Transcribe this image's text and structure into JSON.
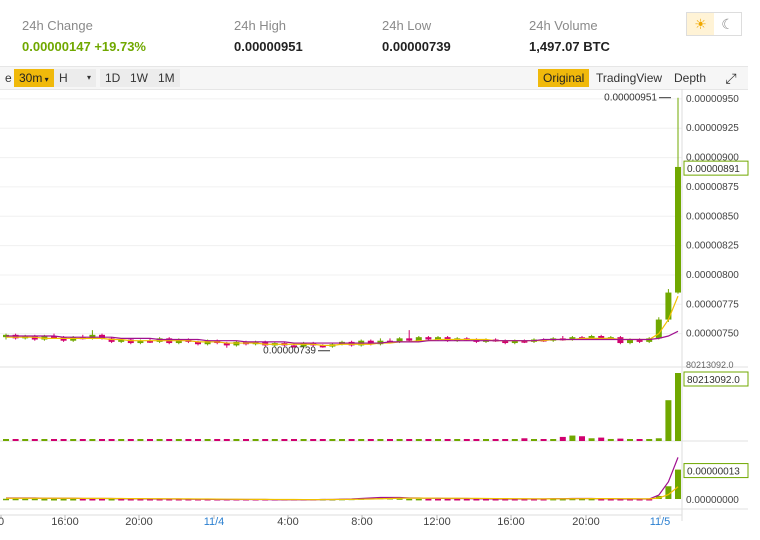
{
  "stats": {
    "change_label": "24h Change",
    "change_value": "0.00000147",
    "change_pct": "+19.73%",
    "high_label": "24h High",
    "high_value": "0.00000951",
    "low_label": "24h Low",
    "low_value": "0.00000739",
    "volume_label": "24h Volume",
    "volume_value": "1,497.07 BTC"
  },
  "theme": {
    "light_icon": "sun-icon",
    "dark_icon": "moon-icon"
  },
  "toolbar": {
    "partial_label": "e",
    "intervals": [
      "30m",
      "H",
      "1D",
      "1W",
      "1M"
    ],
    "active_interval": "30m",
    "views": [
      "Original",
      "TradingView",
      "Depth"
    ],
    "active_view": "Original",
    "expand_icon": "fullscreen-icon"
  },
  "colors": {
    "up": "#70a800",
    "down": "#d0006f",
    "accent": "#f0b90b",
    "ma1": "#f0c000",
    "ma2": "#a01090"
  },
  "chart_data": {
    "type": "candlestick",
    "x_ticks": [
      "0",
      "16:00",
      "20:00",
      "11/4",
      "4:00",
      "8:00",
      "12:00",
      "16:00",
      "20:00",
      "11/5"
    ],
    "x_ticks_highlight": [
      "11/4",
      "11/5"
    ],
    "price_axis": {
      "ticks": [
        "0.00000950",
        "0.00000925",
        "0.00000900",
        "0.00000875",
        "0.00000850",
        "0.00000825",
        "0.00000800",
        "0.00000775",
        "0.00000750"
      ],
      "ylim": [
        7.25e-06,
        9.55e-06
      ],
      "current_label": "0.00000891"
    },
    "high_marker": "0.00000951",
    "low_marker": "0.00000739",
    "volume_axis": {
      "top_label": "80213092.0",
      "current_label": "80213092.0"
    },
    "indicator_axis": {
      "current_label": "0.00000013",
      "zero_label": "0.00000000"
    },
    "candles": [
      [
        7.47,
        7.49,
        7.45,
        7.5
      ],
      [
        7.49,
        7.46,
        7.45,
        7.5
      ],
      [
        7.46,
        7.48,
        7.45,
        7.49
      ],
      [
        7.48,
        7.45,
        7.44,
        7.49
      ],
      [
        7.45,
        7.48,
        7.44,
        7.49
      ],
      [
        7.48,
        7.47,
        7.46,
        7.5
      ],
      [
        7.47,
        7.44,
        7.43,
        7.48
      ],
      [
        7.44,
        7.47,
        7.43,
        7.48
      ],
      [
        7.47,
        7.46,
        7.45,
        7.49
      ],
      [
        7.46,
        7.49,
        7.45,
        7.53
      ],
      [
        7.49,
        7.46,
        7.45,
        7.5
      ],
      [
        7.46,
        7.43,
        7.42,
        7.47
      ],
      [
        7.43,
        7.45,
        7.42,
        7.46
      ],
      [
        7.45,
        7.42,
        7.41,
        7.46
      ],
      [
        7.42,
        7.44,
        7.41,
        7.45
      ],
      [
        7.44,
        7.43,
        7.42,
        7.46
      ],
      [
        7.43,
        7.46,
        7.42,
        7.47
      ],
      [
        7.46,
        7.42,
        7.41,
        7.47
      ],
      [
        7.42,
        7.45,
        7.41,
        7.46
      ],
      [
        7.45,
        7.43,
        7.42,
        7.46
      ],
      [
        7.43,
        7.41,
        7.4,
        7.44
      ],
      [
        7.41,
        7.44,
        7.4,
        7.45
      ],
      [
        7.44,
        7.42,
        7.41,
        7.45
      ],
      [
        7.42,
        7.4,
        7.38,
        7.43
      ],
      [
        7.4,
        7.43,
        7.39,
        7.44
      ],
      [
        7.43,
        7.41,
        7.4,
        7.44
      ],
      [
        7.41,
        7.43,
        7.4,
        7.44
      ],
      [
        7.43,
        7.4,
        7.39,
        7.44
      ],
      [
        7.4,
        7.42,
        7.39,
        7.43
      ],
      [
        7.42,
        7.4,
        7.39,
        7.43
      ],
      [
        7.4,
        7.39,
        7.38,
        7.42
      ],
      [
        7.39,
        7.42,
        7.38,
        7.43
      ],
      [
        7.42,
        7.4,
        7.39,
        7.43
      ],
      [
        7.4,
        7.39,
        7.38,
        7.41
      ],
      [
        7.39,
        7.41,
        7.38,
        7.42
      ],
      [
        7.41,
        7.43,
        7.4,
        7.44
      ],
      [
        7.43,
        7.4,
        7.39,
        7.44
      ],
      [
        7.4,
        7.44,
        7.39,
        7.45
      ],
      [
        7.44,
        7.41,
        7.4,
        7.45
      ],
      [
        7.41,
        7.44,
        7.4,
        7.46
      ],
      [
        7.44,
        7.43,
        7.42,
        7.46
      ],
      [
        7.43,
        7.46,
        7.42,
        7.47
      ],
      [
        7.46,
        7.44,
        7.43,
        7.53
      ],
      [
        7.44,
        7.47,
        7.43,
        7.48
      ],
      [
        7.47,
        7.45,
        7.44,
        7.48
      ],
      [
        7.45,
        7.47,
        7.44,
        7.48
      ],
      [
        7.47,
        7.44,
        7.43,
        7.48
      ],
      [
        7.44,
        7.46,
        7.43,
        7.47
      ],
      [
        7.46,
        7.45,
        7.44,
        7.47
      ],
      [
        7.45,
        7.43,
        7.42,
        7.46
      ],
      [
        7.43,
        7.45,
        7.42,
        7.46
      ],
      [
        7.45,
        7.44,
        7.43,
        7.46
      ],
      [
        7.44,
        7.42,
        7.41,
        7.45
      ],
      [
        7.42,
        7.44,
        7.41,
        7.45
      ],
      [
        7.44,
        7.43,
        7.42,
        7.45
      ],
      [
        7.43,
        7.45,
        7.42,
        7.46
      ],
      [
        7.45,
        7.44,
        7.43,
        7.46
      ],
      [
        7.44,
        7.46,
        7.43,
        7.47
      ],
      [
        7.46,
        7.45,
        7.44,
        7.48
      ],
      [
        7.45,
        7.47,
        7.44,
        7.48
      ],
      [
        7.47,
        7.46,
        7.45,
        7.48
      ],
      [
        7.46,
        7.48,
        7.45,
        7.49
      ],
      [
        7.48,
        7.46,
        7.45,
        7.49
      ],
      [
        7.46,
        7.47,
        7.45,
        7.48
      ],
      [
        7.47,
        7.42,
        7.41,
        7.48
      ],
      [
        7.42,
        7.45,
        7.41,
        7.46
      ],
      [
        7.45,
        7.43,
        7.42,
        7.46
      ],
      [
        7.43,
        7.46,
        7.42,
        7.47
      ],
      [
        7.46,
        7.62,
        7.45,
        7.64
      ],
      [
        7.62,
        7.85,
        7.6,
        7.88
      ],
      [
        7.85,
        8.92,
        7.84,
        9.51
      ]
    ],
    "ma_fast": [
      7.47,
      7.47,
      7.47,
      7.47,
      7.46,
      7.46,
      7.46,
      7.46,
      7.46,
      7.46,
      7.46,
      7.45,
      7.45,
      7.44,
      7.44,
      7.44,
      7.44,
      7.44,
      7.44,
      7.44,
      7.43,
      7.43,
      7.43,
      7.42,
      7.42,
      7.42,
      7.42,
      7.41,
      7.41,
      7.41,
      7.41,
      7.41,
      7.41,
      7.4,
      7.4,
      7.41,
      7.41,
      7.41,
      7.41,
      7.42,
      7.42,
      7.43,
      7.43,
      7.44,
      7.44,
      7.45,
      7.45,
      7.45,
      7.45,
      7.45,
      7.45,
      7.44,
      7.44,
      7.44,
      7.44,
      7.44,
      7.44,
      7.45,
      7.45,
      7.45,
      7.46,
      7.46,
      7.46,
      7.46,
      7.45,
      7.45,
      7.45,
      7.45,
      7.5,
      7.62,
      7.82
    ],
    "ma_slow": [
      7.48,
      7.48,
      7.48,
      7.48,
      7.48,
      7.48,
      7.47,
      7.47,
      7.47,
      7.47,
      7.47,
      7.47,
      7.46,
      7.46,
      7.46,
      7.46,
      7.45,
      7.45,
      7.45,
      7.45,
      7.45,
      7.44,
      7.44,
      7.44,
      7.44,
      7.43,
      7.43,
      7.43,
      7.43,
      7.43,
      7.42,
      7.42,
      7.42,
      7.42,
      7.42,
      7.42,
      7.42,
      7.42,
      7.42,
      7.42,
      7.43,
      7.43,
      7.43,
      7.43,
      7.44,
      7.44,
      7.44,
      7.44,
      7.44,
      7.44,
      7.44,
      7.44,
      7.44,
      7.44,
      7.44,
      7.44,
      7.45,
      7.45,
      7.45,
      7.45,
      7.45,
      7.45,
      7.45,
      7.45,
      7.45,
      7.45,
      7.45,
      7.45,
      7.46,
      7.48,
      7.52
    ],
    "volume": [
      0.01,
      0.015,
      0.01,
      0.012,
      0.008,
      0.01,
      0.015,
      0.01,
      0.008,
      0.01,
      0.012,
      0.01,
      0.015,
      0.01,
      0.008,
      0.01,
      0.01,
      0.012,
      0.01,
      0.008,
      0.01,
      0.012,
      0.01,
      0.015,
      0.01,
      0.008,
      0.01,
      0.012,
      0.01,
      0.01,
      0.015,
      0.01,
      0.008,
      0.01,
      0.012,
      0.01,
      0.01,
      0.015,
      0.01,
      0.008,
      0.01,
      0.012,
      0.01,
      0.01,
      0.008,
      0.015,
      0.01,
      0.012,
      0.01,
      0.008,
      0.01,
      0.01,
      0.012,
      0.01,
      0.04,
      0.015,
      0.01,
      0.012,
      0.06,
      0.08,
      0.07,
      0.04,
      0.05,
      0.03,
      0.035,
      0.02,
      0.01,
      0.015,
      0.04,
      0.6,
      1.0
    ],
    "indicator_dif": [
      0.02,
      0.02,
      0.02,
      0.02,
      0.015,
      0.015,
      0.015,
      0.015,
      0.01,
      0.01,
      0.01,
      0.01,
      0.005,
      0.005,
      0.005,
      0.0,
      0.0,
      0.0,
      0.0,
      -0.005,
      -0.005,
      -0.005,
      -0.01,
      -0.01,
      -0.01,
      -0.01,
      -0.01,
      -0.01,
      -0.015,
      -0.015,
      -0.015,
      -0.015,
      -0.015,
      -0.01,
      -0.01,
      -0.005,
      0.0,
      0.01,
      0.02,
      0.03,
      0.03,
      0.03,
      0.02,
      0.02,
      0.015,
      0.015,
      0.01,
      0.01,
      0.01,
      0.005,
      0.005,
      0.0,
      0.0,
      0.0,
      0.0,
      0.0,
      0.0,
      0.005,
      0.005,
      0.01,
      0.01,
      0.01,
      0.005,
      0.005,
      0.0,
      0.0,
      0.0,
      0.0,
      0.08,
      0.35,
      0.85
    ],
    "indicator_dea": [
      0.015,
      0.015,
      0.015,
      0.015,
      0.015,
      0.015,
      0.015,
      0.015,
      0.012,
      0.012,
      0.012,
      0.01,
      0.01,
      0.008,
      0.008,
      0.006,
      0.005,
      0.004,
      0.003,
      0.002,
      0.0,
      0.0,
      -0.002,
      -0.004,
      -0.005,
      -0.006,
      -0.007,
      -0.008,
      -0.009,
      -0.01,
      -0.01,
      -0.011,
      -0.012,
      -0.011,
      -0.01,
      -0.009,
      -0.007,
      -0.004,
      0.0,
      0.005,
      0.01,
      0.015,
      0.017,
      0.018,
      0.018,
      0.017,
      0.016,
      0.015,
      0.014,
      0.012,
      0.011,
      0.009,
      0.008,
      0.006,
      0.005,
      0.004,
      0.003,
      0.003,
      0.004,
      0.005,
      0.006,
      0.007,
      0.007,
      0.007,
      0.006,
      0.005,
      0.004,
      0.003,
      0.02,
      0.09,
      0.25
    ],
    "indicator_hist": [
      0.005,
      0.005,
      0.005,
      0.005,
      0.0,
      0.0,
      0.0,
      0.0,
      -0.002,
      -0.002,
      -0.002,
      0.0,
      -0.005,
      -0.003,
      -0.003,
      -0.006,
      -0.005,
      -0.004,
      -0.003,
      -0.007,
      -0.005,
      -0.005,
      -0.008,
      -0.006,
      -0.005,
      -0.004,
      -0.003,
      -0.002,
      -0.006,
      -0.005,
      -0.005,
      -0.004,
      -0.003,
      0.001,
      0.0,
      0.004,
      0.007,
      0.014,
      0.02,
      0.025,
      0.02,
      0.015,
      0.003,
      0.002,
      -0.003,
      -0.002,
      -0.006,
      -0.005,
      -0.004,
      -0.007,
      -0.006,
      -0.009,
      -0.008,
      -0.006,
      -0.005,
      -0.004,
      -0.003,
      0.002,
      0.001,
      0.005,
      0.004,
      0.003,
      -0.002,
      -0.002,
      -0.006,
      -0.005,
      -0.004,
      -0.003,
      0.06,
      0.26,
      0.6
    ]
  }
}
